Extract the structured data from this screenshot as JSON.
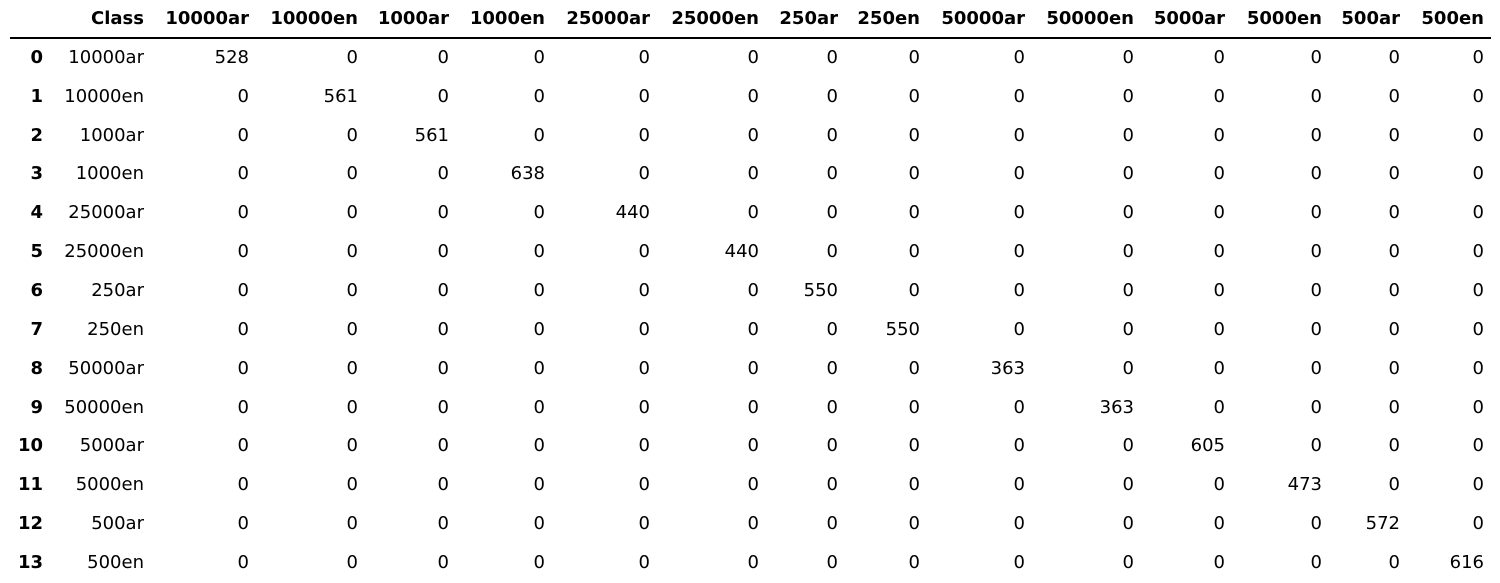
{
  "table": {
    "columns": [
      "",
      "Class",
      "10000ar",
      "10000en",
      "1000ar",
      "1000en",
      "25000ar",
      "25000en",
      "250ar",
      "250en",
      "50000ar",
      "50000en",
      "5000ar",
      "5000en",
      "500ar",
      "500en"
    ],
    "rows": [
      {
        "index": "0",
        "class": "10000ar",
        "values": [
          "528",
          "0",
          "0",
          "0",
          "0",
          "0",
          "0",
          "0",
          "0",
          "0",
          "0",
          "0",
          "0",
          "0"
        ]
      },
      {
        "index": "1",
        "class": "10000en",
        "values": [
          "0",
          "561",
          "0",
          "0",
          "0",
          "0",
          "0",
          "0",
          "0",
          "0",
          "0",
          "0",
          "0",
          "0"
        ]
      },
      {
        "index": "2",
        "class": "1000ar",
        "values": [
          "0",
          "0",
          "561",
          "0",
          "0",
          "0",
          "0",
          "0",
          "0",
          "0",
          "0",
          "0",
          "0",
          "0"
        ]
      },
      {
        "index": "3",
        "class": "1000en",
        "values": [
          "0",
          "0",
          "0",
          "638",
          "0",
          "0",
          "0",
          "0",
          "0",
          "0",
          "0",
          "0",
          "0",
          "0"
        ]
      },
      {
        "index": "4",
        "class": "25000ar",
        "values": [
          "0",
          "0",
          "0",
          "0",
          "440",
          "0",
          "0",
          "0",
          "0",
          "0",
          "0",
          "0",
          "0",
          "0"
        ]
      },
      {
        "index": "5",
        "class": "25000en",
        "values": [
          "0",
          "0",
          "0",
          "0",
          "0",
          "440",
          "0",
          "0",
          "0",
          "0",
          "0",
          "0",
          "0",
          "0"
        ]
      },
      {
        "index": "6",
        "class": "250ar",
        "values": [
          "0",
          "0",
          "0",
          "0",
          "0",
          "0",
          "550",
          "0",
          "0",
          "0",
          "0",
          "0",
          "0",
          "0"
        ]
      },
      {
        "index": "7",
        "class": "250en",
        "values": [
          "0",
          "0",
          "0",
          "0",
          "0",
          "0",
          "0",
          "550",
          "0",
          "0",
          "0",
          "0",
          "0",
          "0"
        ]
      },
      {
        "index": "8",
        "class": "50000ar",
        "values": [
          "0",
          "0",
          "0",
          "0",
          "0",
          "0",
          "0",
          "0",
          "363",
          "0",
          "0",
          "0",
          "0",
          "0"
        ]
      },
      {
        "index": "9",
        "class": "50000en",
        "values": [
          "0",
          "0",
          "0",
          "0",
          "0",
          "0",
          "0",
          "0",
          "0",
          "363",
          "0",
          "0",
          "0",
          "0"
        ]
      },
      {
        "index": "10",
        "class": "5000ar",
        "values": [
          "0",
          "0",
          "0",
          "0",
          "0",
          "0",
          "0",
          "0",
          "0",
          "0",
          "605",
          "0",
          "0",
          "0"
        ]
      },
      {
        "index": "11",
        "class": "5000en",
        "values": [
          "0",
          "0",
          "0",
          "0",
          "0",
          "0",
          "0",
          "0",
          "0",
          "0",
          "0",
          "473",
          "0",
          "0"
        ]
      },
      {
        "index": "12",
        "class": "500ar",
        "values": [
          "0",
          "0",
          "0",
          "0",
          "0",
          "0",
          "0",
          "0",
          "0",
          "0",
          "0",
          "0",
          "572",
          "0"
        ]
      },
      {
        "index": "13",
        "class": "500en",
        "values": [
          "0",
          "0",
          "0",
          "0",
          "0",
          "0",
          "0",
          "0",
          "0",
          "0",
          "0",
          "0",
          "0",
          "616"
        ]
      }
    ]
  }
}
